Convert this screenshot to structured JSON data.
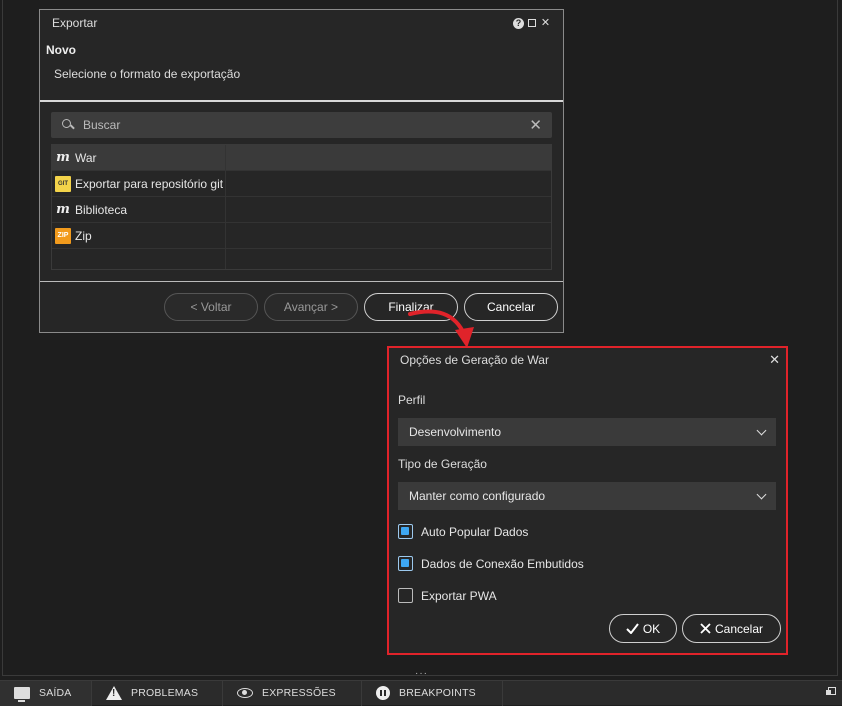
{
  "export_dialog": {
    "title": "Exportar",
    "section_title": "Novo",
    "section_subtitle": "Selecione o formato de exportação",
    "search": {
      "placeholder": "Buscar",
      "value": ""
    },
    "items": [
      {
        "label": "War",
        "icon": "war-icon",
        "selected": true
      },
      {
        "label": "Exportar para repositório git",
        "icon": "git-icon",
        "selected": false
      },
      {
        "label": "Biblioteca",
        "icon": "library-icon",
        "selected": false
      },
      {
        "label": "Zip",
        "icon": "zip-icon",
        "selected": false
      }
    ],
    "icon_text": {
      "git": "GIT",
      "zip": "ZIP",
      "war": "m"
    },
    "buttons": {
      "back": "< Voltar",
      "next": "Avançar >",
      "finish": "Finalizar",
      "cancel": "Cancelar"
    }
  },
  "war_dialog": {
    "title": "Opções de Geração de War",
    "perfil_label": "Perfil",
    "perfil_value": "Desenvolvimento",
    "tipo_label": "Tipo de Geração",
    "tipo_value": "Manter como configurado",
    "checkboxes": [
      {
        "label": "Auto Popular Dados",
        "checked": true
      },
      {
        "label": "Dados de Conexão Embutidos",
        "checked": true
      },
      {
        "label": "Exportar PWA",
        "checked": false
      }
    ],
    "ok_label": "OK",
    "cancel_label": "Cancelar",
    "border_color": "#e0232a"
  },
  "bottom_panel": {
    "tabs": [
      {
        "label": "SAÍDA",
        "icon": "monitor-icon",
        "active": true
      },
      {
        "label": "PROBLEMAS",
        "icon": "warning-icon",
        "active": false
      },
      {
        "label": "EXPRESSÕES",
        "icon": "eye-icon",
        "active": false
      },
      {
        "label": "BREAKPOINTS",
        "icon": "pause-icon",
        "active": false
      }
    ]
  },
  "colors": {
    "accent": "#3ea7f2",
    "highlight": "#e0232a"
  }
}
